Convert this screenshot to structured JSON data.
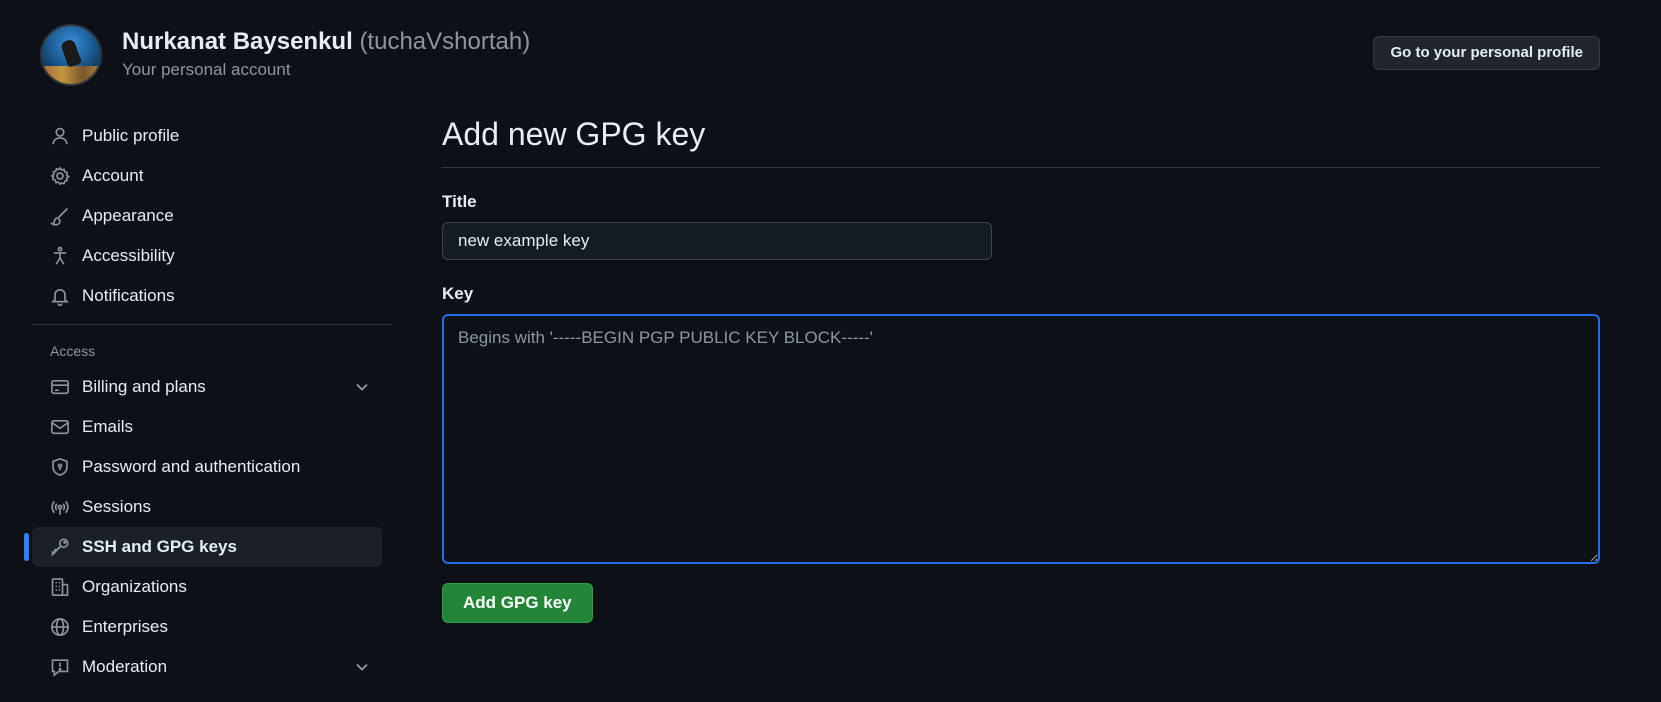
{
  "header": {
    "name": "Nurkanat Baysenkul",
    "login": "(tuchaVshortah)",
    "subtitle": "Your personal account",
    "profile_button": "Go to your personal profile"
  },
  "sidebar": {
    "items_top": [
      {
        "label": "Public profile",
        "icon": "person-icon"
      },
      {
        "label": "Account",
        "icon": "gear-icon"
      },
      {
        "label": "Appearance",
        "icon": "paintbrush-icon"
      },
      {
        "label": "Accessibility",
        "icon": "accessibility-icon"
      },
      {
        "label": "Notifications",
        "icon": "bell-icon"
      }
    ],
    "access_label": "Access",
    "items_access": [
      {
        "label": "Billing and plans",
        "icon": "credit-card-icon",
        "expandable": true
      },
      {
        "label": "Emails",
        "icon": "mail-icon"
      },
      {
        "label": "Password and authentication",
        "icon": "shield-lock-icon"
      },
      {
        "label": "Sessions",
        "icon": "broadcast-icon"
      },
      {
        "label": "SSH and GPG keys",
        "icon": "key-icon",
        "active": true
      },
      {
        "label": "Organizations",
        "icon": "organization-icon"
      },
      {
        "label": "Enterprises",
        "icon": "globe-icon"
      },
      {
        "label": "Moderation",
        "icon": "report-icon",
        "expandable": true
      }
    ]
  },
  "main": {
    "title": "Add new GPG key",
    "title_field_label": "Title",
    "title_value": "new example key",
    "key_field_label": "Key",
    "key_placeholder": "Begins with '-----BEGIN PGP PUBLIC KEY BLOCK-----'",
    "submit_label": "Add GPG key"
  },
  "colors": {
    "background": "#0d1117",
    "accent": "#2f81f7",
    "primary_button": "#238636"
  }
}
